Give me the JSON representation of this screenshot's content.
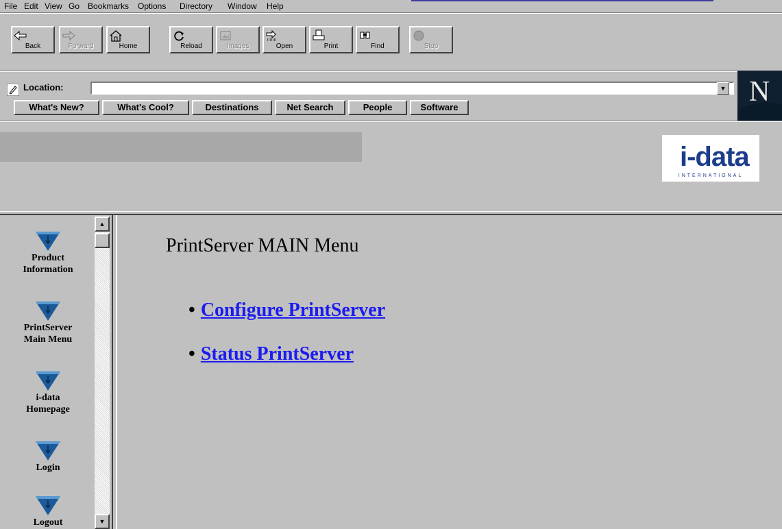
{
  "menu": [
    "File",
    "Edit",
    "View",
    "Go",
    "Bookmarks",
    "Options",
    "Directory",
    "Window",
    "Help"
  ],
  "toolbar": {
    "buttons": [
      {
        "label": "Back",
        "icon": "back-arrow-icon",
        "enabled": true
      },
      {
        "label": "Forward",
        "icon": "forward-arrow-icon",
        "enabled": false
      },
      {
        "label": "Home",
        "icon": "home-icon",
        "enabled": true
      },
      {
        "label": "Reload",
        "icon": "reload-icon",
        "enabled": true
      },
      {
        "label": "Images",
        "icon": "images-icon",
        "enabled": false
      },
      {
        "label": "Open",
        "icon": "open-icon",
        "enabled": true
      },
      {
        "label": "Print",
        "icon": "print-icon",
        "enabled": true
      },
      {
        "label": "Find",
        "icon": "find-icon",
        "enabled": true
      },
      {
        "label": "Stop",
        "icon": "stop-icon",
        "enabled": false
      }
    ]
  },
  "location": {
    "label": "Location:",
    "value": ""
  },
  "directory_buttons": [
    "What's New?",
    "What's Cool?",
    "Destinations",
    "Net Search",
    "People",
    "Software"
  ],
  "browser_logo": "N",
  "banner": {
    "logo_text": "i-data",
    "logo_subtext": "INTERNATIONAL"
  },
  "nav": [
    {
      "label_line1": "Product",
      "label_line2": "Information"
    },
    {
      "label_line1": "PrintServer",
      "label_line2": "Main Menu"
    },
    {
      "label_line1": "i-data",
      "label_line2": "Homepage"
    },
    {
      "label_line1": "Login",
      "label_line2": ""
    },
    {
      "label_line1": "Logout",
      "label_line2": ""
    }
  ],
  "main": {
    "title": "PrintServer MAIN Menu",
    "links": [
      "Configure PrintServer",
      "Status PrintServer"
    ]
  },
  "colors": {
    "link": "#1c1cf0",
    "window_bg": "#c0c0c0",
    "logo_blue": "#1c3c8c"
  }
}
